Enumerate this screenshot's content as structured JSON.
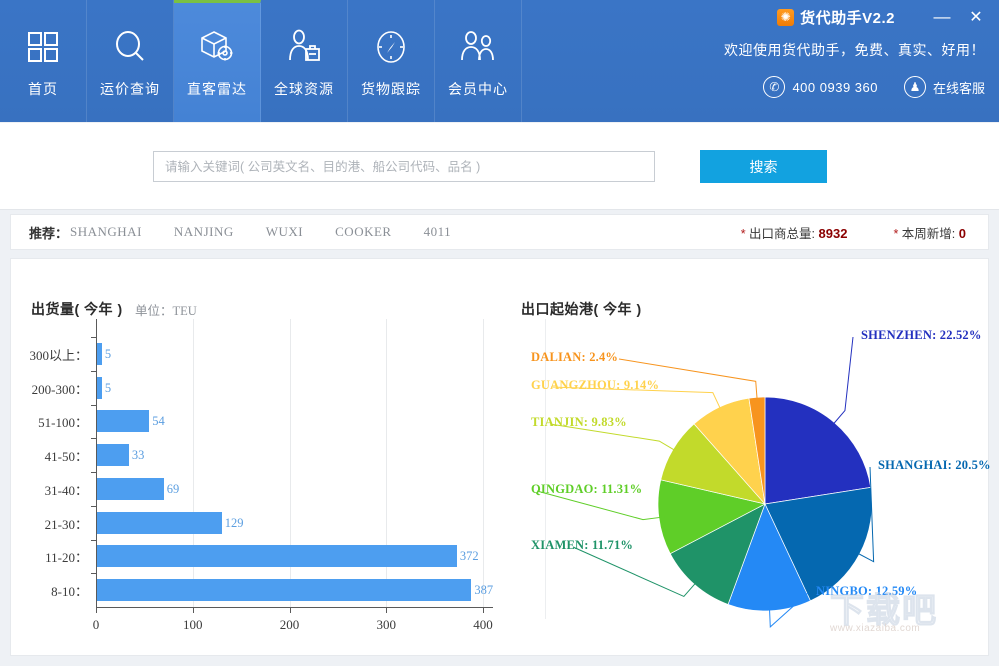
{
  "window": {
    "app_title": "货代助手V2.2",
    "logo_glyph": "✺",
    "minimize_label": "—",
    "close_label": "✕",
    "welcome_text": "欢迎使用货代助手，免费、真实、好用！",
    "phone_icon": "✆",
    "phone_number": "400 0939 360",
    "service_icon": "♟",
    "service_label": "在线客服"
  },
  "nav": {
    "items": [
      {
        "label": "首页",
        "icon": "grid-icon",
        "active": false
      },
      {
        "label": "运价查询",
        "icon": "magnifier-icon",
        "active": false
      },
      {
        "label": "直客雷达",
        "icon": "box-radar-icon",
        "active": true
      },
      {
        "label": "全球资源",
        "icon": "person-briefcase-icon",
        "active": false
      },
      {
        "label": "货物跟踪",
        "icon": "compass-icon",
        "active": false
      },
      {
        "label": "会员中心",
        "icon": "two-people-icon",
        "active": false
      }
    ]
  },
  "search": {
    "value": "",
    "placeholder": "请输入关键词( 公司英文名、目的港、船公司代码、品名 )",
    "button_label": "搜索"
  },
  "recommend": {
    "label": "推荐：",
    "items": [
      "SHANGHAI",
      "NANJING",
      "WUXI",
      "COOKER",
      "4011"
    ],
    "stats": [
      {
        "star": "*",
        "label": "出口商总量:",
        "value": "8932"
      },
      {
        "star": "*",
        "label": "本周新增:",
        "value": "0"
      }
    ]
  },
  "watermark": {
    "text": "下载吧",
    "url": "www.xiazaiba.com"
  },
  "chart_data": [
    {
      "type": "bar",
      "orientation": "horizontal",
      "title": "出货量( 今年 )",
      "unit_label": "单位：TEU",
      "xlabel": "",
      "ylabel": "",
      "categories": [
        "300以上：",
        "200-300：",
        "51-100：",
        "41-50：",
        "31-40：",
        "21-30：",
        "11-20：",
        "8-10："
      ],
      "values": [
        5,
        5,
        54,
        33,
        69,
        129,
        372,
        387
      ],
      "xticks": [
        0,
        100,
        200,
        300,
        400
      ],
      "xlim": [
        0,
        400
      ],
      "grid": true,
      "bar_color": "#4d9ef0",
      "value_label_color": "#5b9ee0"
    },
    {
      "type": "pie",
      "title": "出口起始港( 今年 )",
      "legend": "labels-with-leader-lines",
      "slices": [
        {
          "name": "SHENZHEN",
          "value": 22.52,
          "label": "SHENZHEN: 22.52%",
          "color": "#2330bf"
        },
        {
          "name": "SHANGHAI",
          "value": 20.5,
          "label": "SHANGHAI: 20.5%",
          "color": "#0568b0"
        },
        {
          "name": "NINGBO",
          "value": 12.59,
          "label": "NINGBO: 12.59%",
          "color": "#2489f5"
        },
        {
          "name": "XIAMEN",
          "value": 11.71,
          "label": "XIAMEN: 11.71%",
          "color": "#1f9368"
        },
        {
          "name": "QINGDAO",
          "value": 11.31,
          "label": "QINGDAO: 11.31%",
          "color": "#5fce28"
        },
        {
          "name": "TIANJIN",
          "value": 9.83,
          "label": "TIANJIN: 9.83%",
          "color": "#c2da2b"
        },
        {
          "name": "GUANGZHOU",
          "value": 9.14,
          "label": "GUANGZHOU: 9.14%",
          "color": "#ffd24d"
        },
        {
          "name": "DALIAN",
          "value": 2.4,
          "label": "DALIAN: 2.4%",
          "color": "#f7941e"
        }
      ]
    }
  ]
}
